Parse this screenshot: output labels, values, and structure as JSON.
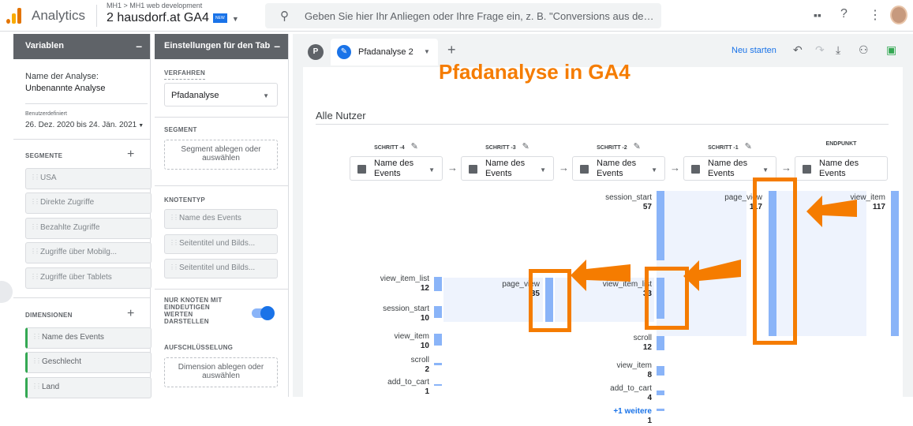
{
  "header": {
    "app_name": "Analytics",
    "breadcrumb": "MH1 > MH1 web development",
    "property": "2 hausdorf.at GA4",
    "new_badge": "NEW",
    "search_placeholder": "Geben Sie hier Ihr Anliegen oder Ihre Frage ein, z. B. \"Conversions aus de…",
    "icons": [
      "apps-icon",
      "help-icon",
      "more-vert-icon",
      "avatar"
    ],
    "brand_colors": [
      "#f9ab00",
      "#e37400"
    ]
  },
  "variables": {
    "title": "Variablen",
    "minimize": "–",
    "analysis_name_label": "Name der Analyse:",
    "analysis_name": "Unbenannte Analyse",
    "date_label": "Benutzerdefiniert",
    "date_range": "26. Dez. 2020 bis 24. Jän. 2021",
    "segments_label": "SEGMENTE",
    "segments": [
      "USA",
      "Direkte Zugriffe",
      "Bezahlte Zugriffe",
      "Zugriffe über Mobilg...",
      "Zugriffe über Tablets"
    ],
    "dimensions_label": "DIMENSIONEN",
    "dimensions": [
      "Name des Events",
      "Geschlecht",
      "Land"
    ]
  },
  "tab_settings": {
    "title": "Einstellungen für den Tab",
    "minimize": "–",
    "technique_label": "VERFAHREN",
    "technique": "Pfadanalyse",
    "segment_label": "SEGMENT",
    "segment_drop": "Segment ablegen oder auswählen",
    "node_type_label": "KNOTENTYP",
    "node_types": [
      "Name des Events",
      "Seitentitel und Bilds...",
      "Seitentitel und Bilds..."
    ],
    "unique_only_label": "NUR KNOTEN MIT EINDEUTIGEN WERTEN DARSTELLEN",
    "unique_only": true,
    "breakdown_label": "AUFSCHLÜSSELUNG",
    "breakdown_drop": "Dimension ablegen oder auswählen"
  },
  "canvas": {
    "tab_initial": "P",
    "tab_name": "Pfadanalyse 2",
    "add_tab": "+",
    "restart": "Neu starten",
    "toolbar_icons": [
      "undo-icon",
      "redo-icon",
      "download-icon",
      "share-icon",
      "export-icon"
    ],
    "overlay_title": "Pfadanalyse in GA4",
    "segment": "Alle Nutzer",
    "steps": [
      {
        "label": "SCHRITT -4",
        "dim": "Name des Events"
      },
      {
        "label": "SCHRITT -3",
        "dim": "Name des Events"
      },
      {
        "label": "SCHRITT -2",
        "dim": "Name des Events"
      },
      {
        "label": "SCHRITT -1",
        "dim": "Name des Events"
      },
      {
        "label": "ENDPUNKT",
        "dim": "Name des Events"
      }
    ],
    "nodes": {
      "step4": [
        {
          "name": "view_item_list",
          "value": "12"
        },
        {
          "name": "session_start",
          "value": "10"
        },
        {
          "name": "view_item",
          "value": "10"
        },
        {
          "name": "scroll",
          "value": "2"
        },
        {
          "name": "add_to_cart",
          "value": "1"
        }
      ],
      "step3": [
        {
          "name": "page_view",
          "value": "35"
        }
      ],
      "step2": [
        {
          "name": "session_start",
          "value": "57"
        },
        {
          "name": "view_item_list",
          "value": "33"
        },
        {
          "name": "scroll",
          "value": "12"
        },
        {
          "name": "view_item",
          "value": "8"
        },
        {
          "name": "add_to_cart",
          "value": "4"
        },
        {
          "name": "+1 weitere",
          "value": "1"
        }
      ],
      "step1": [
        {
          "name": "page_view",
          "value": "117"
        }
      ],
      "end": [
        {
          "name": "view_item",
          "value": "117"
        }
      ]
    },
    "highlight_color": "#f57c00",
    "bar_color": "#8ab4f8"
  }
}
